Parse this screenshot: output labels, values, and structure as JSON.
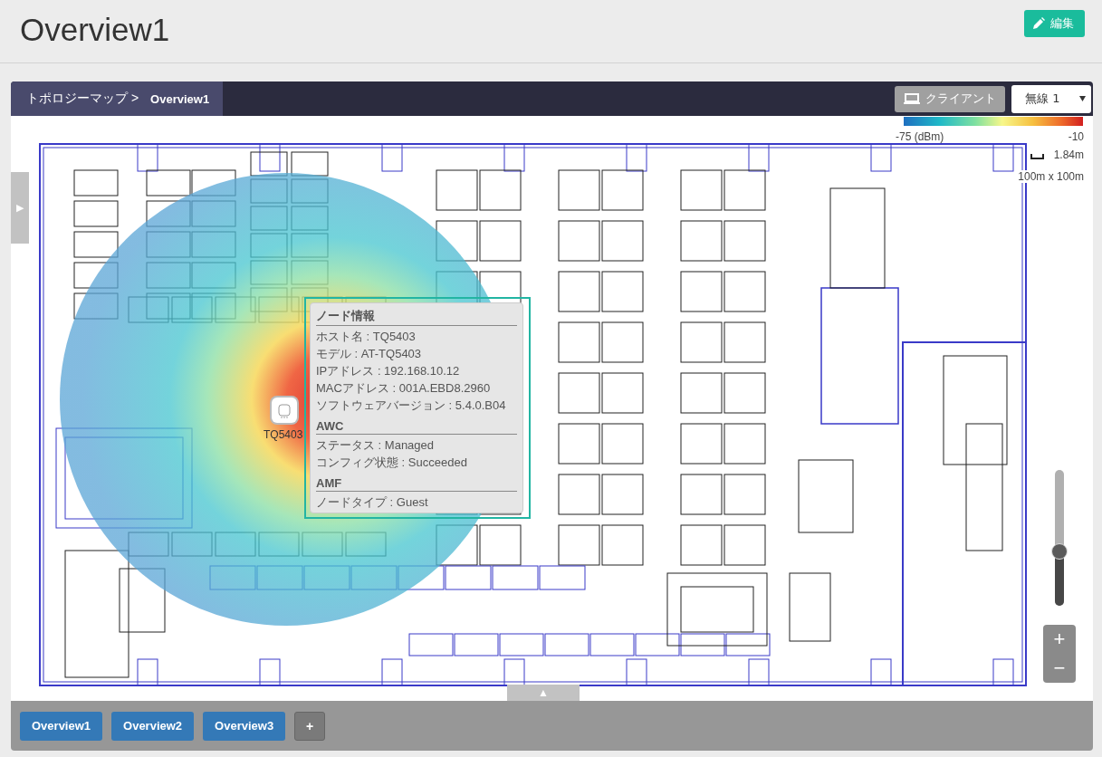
{
  "page": {
    "title": "Overview1",
    "edit_button": "編集"
  },
  "breadcrumb": {
    "parent": "トポロジーマップ >",
    "current": "Overview1"
  },
  "client_button": "クライアント",
  "radio_select": {
    "value": "無線 1"
  },
  "legend": {
    "min": "-75 (dBm)",
    "max": "-10",
    "scale": "1.84m",
    "area": "100m x 100m"
  },
  "side_toggle": "▶",
  "bottom_toggle": "▲",
  "access_point": {
    "label": "TQ5403"
  },
  "tooltip": {
    "sections": [
      {
        "title": "ノード情報",
        "rows": [
          "ホスト名 : TQ5403",
          "モデル : AT-TQ5403",
          "IPアドレス : 192.168.10.12",
          "MACアドレス : 001A.EBD8.2960",
          "ソフトウェアバージョン : 5.4.0.B04"
        ]
      },
      {
        "title": "AWC",
        "rows": [
          "ステータス : Managed",
          "コンフィグ状態 : Succeeded"
        ]
      },
      {
        "title": "AMF",
        "rows": [
          "ノードタイプ : Guest"
        ]
      }
    ]
  },
  "zoom": {
    "level": 0.4,
    "zoom_in": "+",
    "zoom_out": "−"
  },
  "tabs": [
    {
      "label": "Overview1"
    },
    {
      "label": "Overview2"
    },
    {
      "label": "Overview3"
    }
  ],
  "add_tab": "+"
}
